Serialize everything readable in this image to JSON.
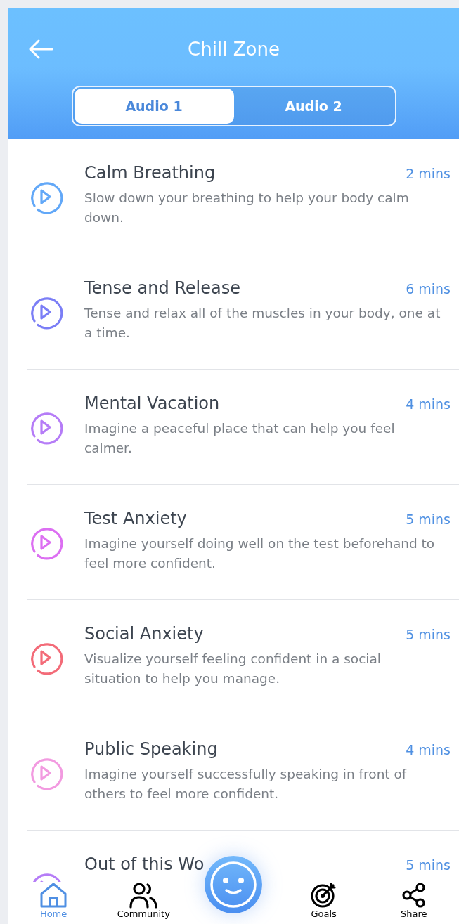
{
  "header": {
    "title": "Chill Zone"
  },
  "tabs": [
    {
      "label": "Audio 1",
      "selected": true
    },
    {
      "label": "Audio 2",
      "selected": false
    }
  ],
  "tracks": [
    {
      "title": "Calm Breathing",
      "duration": "2 mins",
      "description": "Slow down your breathing to help your body calm down.",
      "color": "#62a8f8"
    },
    {
      "title": "Tense and Release",
      "duration": "6 mins",
      "description": "Tense and relax all of the muscles in your body, one at a time.",
      "color": "#7b7ef6"
    },
    {
      "title": "Mental Vacation",
      "duration": "4 mins",
      "description": "Imagine a peaceful place that can help you feel calmer.",
      "color": "#b57cf7"
    },
    {
      "title": "Test Anxiety",
      "duration": "5 mins",
      "description": "Imagine yourself doing well on the test beforehand to feel more confident.",
      "color": "#dc6ff2"
    },
    {
      "title": "Social Anxiety",
      "duration": "5 mins",
      "description": "Visualize yourself feeling confident in a social situation to help you manage.",
      "color": "#f36b78"
    },
    {
      "title": "Public Speaking",
      "duration": "4 mins",
      "description": "Imagine yourself successfully speaking in front of others to feel more confident.",
      "color": "#f29ae0"
    },
    {
      "title": "Out of this Wo",
      "duration": "5 mins",
      "color": "#b57cf7"
    }
  ],
  "nav": [
    {
      "kind": "home",
      "label": "Home",
      "selected": true
    },
    {
      "kind": "community",
      "label": "Community",
      "selected": false
    },
    {
      "kind": "mood"
    },
    {
      "kind": "goals",
      "label": "Goals",
      "selected": false
    },
    {
      "kind": "share",
      "label": "Share",
      "selected": false
    }
  ]
}
